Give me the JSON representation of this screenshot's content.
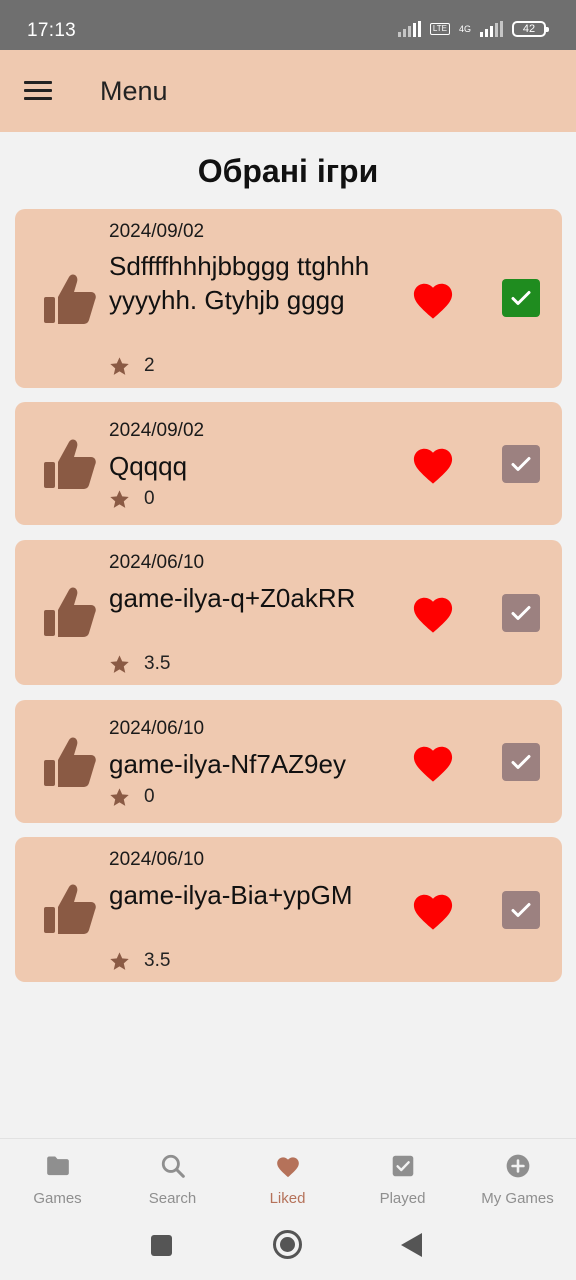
{
  "status": {
    "time": "17:13",
    "net": "4G",
    "lte": "LTE",
    "battery": "42"
  },
  "appbar": {
    "title": "Menu"
  },
  "page": {
    "title": "Обрані ігри"
  },
  "games": [
    {
      "date": "2024/09/02",
      "name": "Sdffffhhhjbbggg ttghhh yyyyhh. Gtyhjb gggg",
      "rating": "2",
      "liked": true,
      "played": true
    },
    {
      "date": "2024/09/02",
      "name": "Qqqqq",
      "rating": "0",
      "liked": true,
      "played": false
    },
    {
      "date": "2024/06/10",
      "name": "game-ilya-q+Z0akRR",
      "rating": "3.5",
      "liked": true,
      "played": false
    },
    {
      "date": "2024/06/10",
      "name": "game-ilya-Nf7AZ9ey",
      "rating": "0",
      "liked": true,
      "played": false
    },
    {
      "date": "2024/06/10",
      "name": "game-ilya-Bia+ypGM",
      "rating": "3.5",
      "liked": true,
      "played": false
    }
  ],
  "nav": [
    {
      "label": "Games",
      "icon": "folder-icon"
    },
    {
      "label": "Search",
      "icon": "search-icon"
    },
    {
      "label": "Liked",
      "icon": "heart-icon"
    },
    {
      "label": "Played",
      "icon": "checkbox-icon"
    },
    {
      "label": "My Games",
      "icon": "add-circle-icon"
    }
  ],
  "colors": {
    "appbar": "#efc9b0",
    "card": "#efc9b0",
    "heart": "#ff0000",
    "checked": "#1f8c1f",
    "unchecked": "#9c8180",
    "accent": "#b5725a",
    "thumb": "#8a5a44"
  }
}
